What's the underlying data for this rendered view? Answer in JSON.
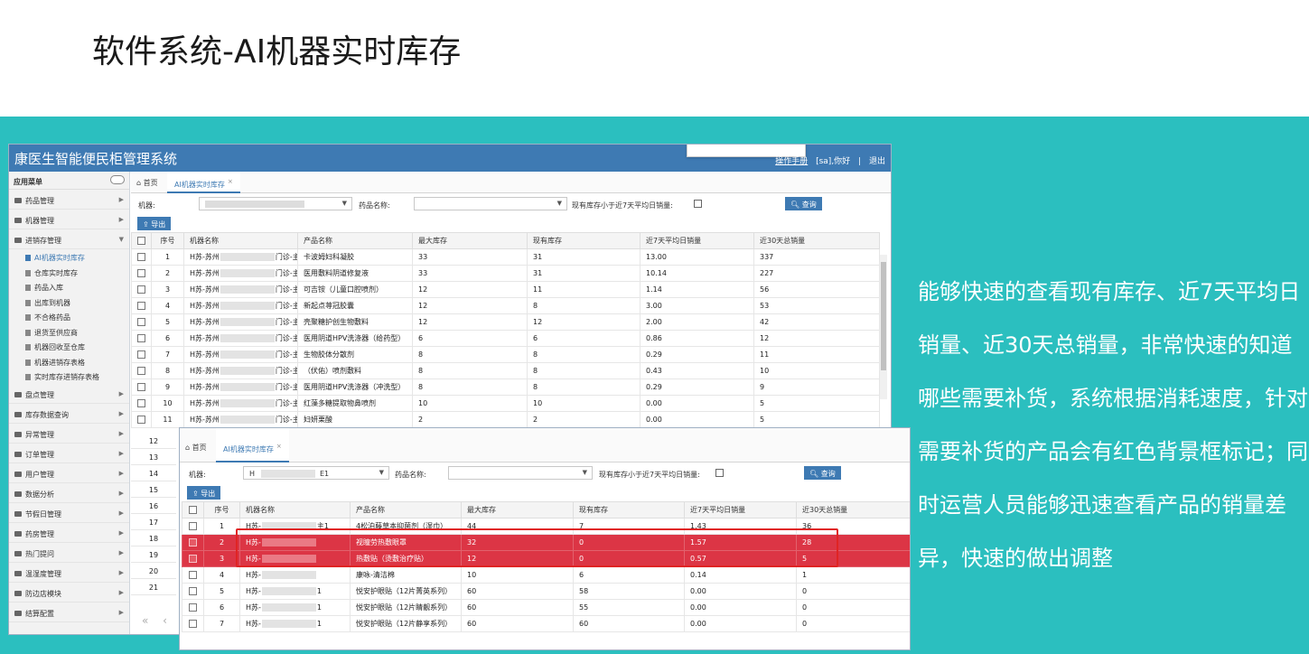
{
  "slide": {
    "title": "软件系统-AI机器实时库存",
    "description": "能够快速的查看现有库存、近7天平均日销量、近30天总销量，非常快速的知道哪些需要补货，系统根据消耗速度，针对需要补货的产品会有红色背景框标记；同时运营人员能够迅速查看产品的销量差异，快速的做出调整"
  },
  "colors": {
    "band": "#2bbfbf",
    "header": "#3e7ab3",
    "highlight": "#dc3545",
    "frame": "#e02424"
  },
  "app": {
    "title": "康医生智能便民柜管理系统",
    "manual_link": "操作手册",
    "greeting": "[sa],你好",
    "separator": "|",
    "logout": "退出"
  },
  "sidebar": {
    "header": "应用菜单",
    "items_top": [
      {
        "label": "药品管理"
      },
      {
        "label": "机器管理"
      }
    ],
    "open_group": "进销存管理",
    "sub_items": [
      {
        "label": "AI机器实时库存",
        "active": true
      },
      {
        "label": "仓库实时库存"
      },
      {
        "label": "药品入库"
      },
      {
        "label": "出库到机器"
      },
      {
        "label": "不合格药品"
      },
      {
        "label": "退货至供应商"
      },
      {
        "label": "机器回收至仓库"
      },
      {
        "label": "机器进销存表格"
      },
      {
        "label": "实时库存进销存表格"
      }
    ],
    "items_bottom": [
      {
        "label": "盘点管理"
      },
      {
        "label": "库存数据查询"
      },
      {
        "label": "异常管理"
      },
      {
        "label": "订单管理"
      },
      {
        "label": "用户管理"
      },
      {
        "label": "数据分析"
      },
      {
        "label": "节假日管理"
      },
      {
        "label": "药房管理"
      },
      {
        "label": "热门提问"
      },
      {
        "label": "温湿度管理"
      },
      {
        "label": "防边店模块"
      },
      {
        "label": "结算配置"
      }
    ]
  },
  "tabs": {
    "home": "首页",
    "active": "AI机器实时库存",
    "close": "×"
  },
  "filters": {
    "machine_label": "机器:",
    "drug_label": "药品名称:",
    "low_stock_label": "现有库存小于近7天平均日销量:",
    "query_button": "查询",
    "export_button": "导出"
  },
  "columns": [
    "序号",
    "机器名称",
    "产品名称",
    "最大库存",
    "现有库存",
    "近7天平均日销量",
    "近30天总销量"
  ],
  "back_rows": [
    {
      "no": "1",
      "mp": "H苏-苏州",
      "ms": "门诊-主1",
      "product": "卡波姆妇科凝胶",
      "max": "33",
      "cur": "31",
      "avg7": "13.00",
      "tot30": "337"
    },
    {
      "no": "2",
      "mp": "H苏-苏州",
      "ms": "门诊-主1",
      "product": "医用敷料阴道修复液",
      "max": "33",
      "cur": "31",
      "avg7": "10.14",
      "tot30": "227"
    },
    {
      "no": "3",
      "mp": "H苏-苏州",
      "ms": "门诊-主1",
      "product": "可吉铵（儿童口腔喷剂）",
      "max": "12",
      "cur": "11",
      "avg7": "1.14",
      "tot30": "56"
    },
    {
      "no": "4",
      "mp": "H苏-苏州",
      "ms": "门诊-主1",
      "product": "新起点荨冠胶囊",
      "max": "12",
      "cur": "8",
      "avg7": "3.00",
      "tot30": "53"
    },
    {
      "no": "5",
      "mp": "H苏-苏州",
      "ms": "门诊-主1",
      "product": "壳聚糖护创生物敷料",
      "max": "12",
      "cur": "12",
      "avg7": "2.00",
      "tot30": "42"
    },
    {
      "no": "6",
      "mp": "H苏-苏州",
      "ms": "门诊-主1",
      "product": "医用阴道HPV洗涤器（给药型）",
      "max": "6",
      "cur": "6",
      "avg7": "0.86",
      "tot30": "12"
    },
    {
      "no": "7",
      "mp": "H苏-苏州",
      "ms": "门诊-主1",
      "product": "生物胶体分散剂",
      "max": "8",
      "cur": "8",
      "avg7": "0.29",
      "tot30": "11"
    },
    {
      "no": "8",
      "mp": "H苏-苏州",
      "ms": "门诊-主1",
      "product": "（伏佑）喷剂敷料",
      "max": "8",
      "cur": "8",
      "avg7": "0.43",
      "tot30": "10"
    },
    {
      "no": "9",
      "mp": "H苏-苏州",
      "ms": "门诊-主1",
      "product": "医用阴道HPV洗涤器（冲洗型）",
      "max": "8",
      "cur": "8",
      "avg7": "0.29",
      "tot30": "9"
    },
    {
      "no": "10",
      "mp": "H苏-苏州",
      "ms": "门诊-主1",
      "product": "红藻多糖提取物鼻喷剂",
      "max": "10",
      "cur": "10",
      "avg7": "0.00",
      "tot30": "5"
    },
    {
      "no": "11",
      "mp": "H苏-苏州",
      "ms": "门诊-主1",
      "product": "妇妍栗酸",
      "max": "2",
      "cur": "2",
      "avg7": "0.00",
      "tot30": "5"
    }
  ],
  "back_more_numbers": [
    "12",
    "13",
    "14",
    "15",
    "16",
    "17",
    "18",
    "19",
    "20",
    "21"
  ],
  "pager_arrows": "« ‹",
  "front_rows": [
    {
      "no": "1",
      "mp": "H苏-",
      "ms": "主1",
      "product": "4松泊藤草本抑菌剂（湿巾）",
      "max": "44",
      "cur": "7",
      "avg7": "1.43",
      "tot30": "36",
      "hl": false
    },
    {
      "no": "2",
      "mp": "H苏-",
      "ms": "",
      "product": "视瞳劳热敷眼罩",
      "max": "32",
      "cur": "0",
      "avg7": "1.57",
      "tot30": "28",
      "hl": true
    },
    {
      "no": "3",
      "mp": "H苏-",
      "ms": "",
      "product": "热敷贴（烫敷治疗贴）",
      "max": "12",
      "cur": "0",
      "avg7": "0.57",
      "tot30": "5",
      "hl": true
    },
    {
      "no": "4",
      "mp": "H苏-",
      "ms": "",
      "product": "康咏-清洁棉",
      "max": "10",
      "cur": "6",
      "avg7": "0.14",
      "tot30": "1",
      "hl": false
    },
    {
      "no": "5",
      "mp": "H苏-",
      "ms": "1",
      "product": "悦安护眼贴（12片菁英系列）",
      "max": "60",
      "cur": "58",
      "avg7": "0.00",
      "tot30": "0",
      "hl": false
    },
    {
      "no": "6",
      "mp": "H苏-",
      "ms": "1",
      "product": "悦安护眼贴（12片睛靓系列）",
      "max": "60",
      "cur": "55",
      "avg7": "0.00",
      "tot30": "0",
      "hl": false
    },
    {
      "no": "7",
      "mp": "H苏-",
      "ms": "1",
      "product": "悦安护眼贴（12片静享系列）",
      "max": "60",
      "cur": "60",
      "avg7": "0.00",
      "tot30": "0",
      "hl": false
    }
  ],
  "front_machine_value": "H",
  "front_machine_suffix": "E1"
}
